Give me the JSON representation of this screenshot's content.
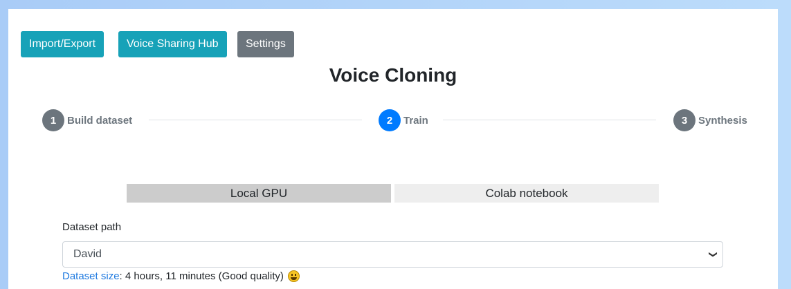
{
  "nav": {
    "import_export": "Import/Export",
    "voice_sharing_hub": "Voice Sharing Hub",
    "settings": "Settings"
  },
  "title": "Voice Cloning",
  "steps": [
    {
      "number": "1",
      "label": "Build dataset",
      "state": "inactive"
    },
    {
      "number": "2",
      "label": "Train",
      "state": "active"
    },
    {
      "number": "3",
      "label": "Synthesis",
      "state": "inactive"
    }
  ],
  "tabs": [
    {
      "label": "Local GPU",
      "active": true
    },
    {
      "label": "Colab notebook",
      "active": false
    }
  ],
  "dataset": {
    "label": "Dataset path",
    "selected": "David",
    "size_link": "Dataset size",
    "size_value": ": 4 hours, 11 minutes (Good quality)",
    "quality_icon": "smile-icon"
  },
  "colors": {
    "info": "#17a2b8",
    "secondary": "#6c757d",
    "primary": "#007bff",
    "link": "#1f7ae0"
  }
}
